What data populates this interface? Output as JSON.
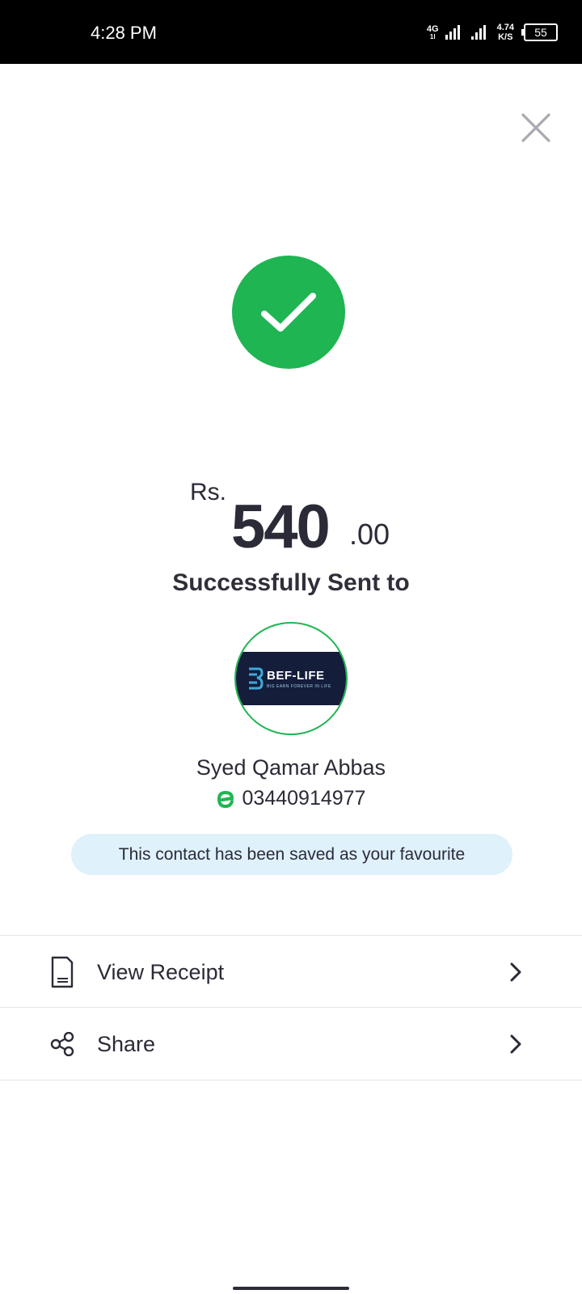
{
  "status_bar": {
    "time": "4:28 PM",
    "network_label_top": "4G",
    "network_label_bottom": "1l",
    "speed_value": "4.74",
    "speed_unit": "K/S",
    "battery": "55"
  },
  "success": {
    "icon": "check-icon",
    "color": "#1fb552"
  },
  "amount": {
    "currency": "Rs.",
    "whole": "540",
    "decimal": ".00"
  },
  "message": "Successfully Sent to",
  "recipient": {
    "avatar_logo_title": "BEF-LIFE",
    "avatar_logo_subtitle": "BIG EARN FOREVER IN LIFE",
    "name": "Syed Qamar Abbas",
    "provider_icon": "easypaisa-icon",
    "phone": "03440914977"
  },
  "favourite_notice": "This contact has been saved as your favourite",
  "actions": [
    {
      "label": "View Receipt",
      "icon": "receipt-icon"
    },
    {
      "label": "Share",
      "icon": "share-icon"
    }
  ],
  "colors": {
    "accent_green": "#1fb552",
    "pill_bg": "#dff1fb",
    "text": "#2b2b38"
  }
}
